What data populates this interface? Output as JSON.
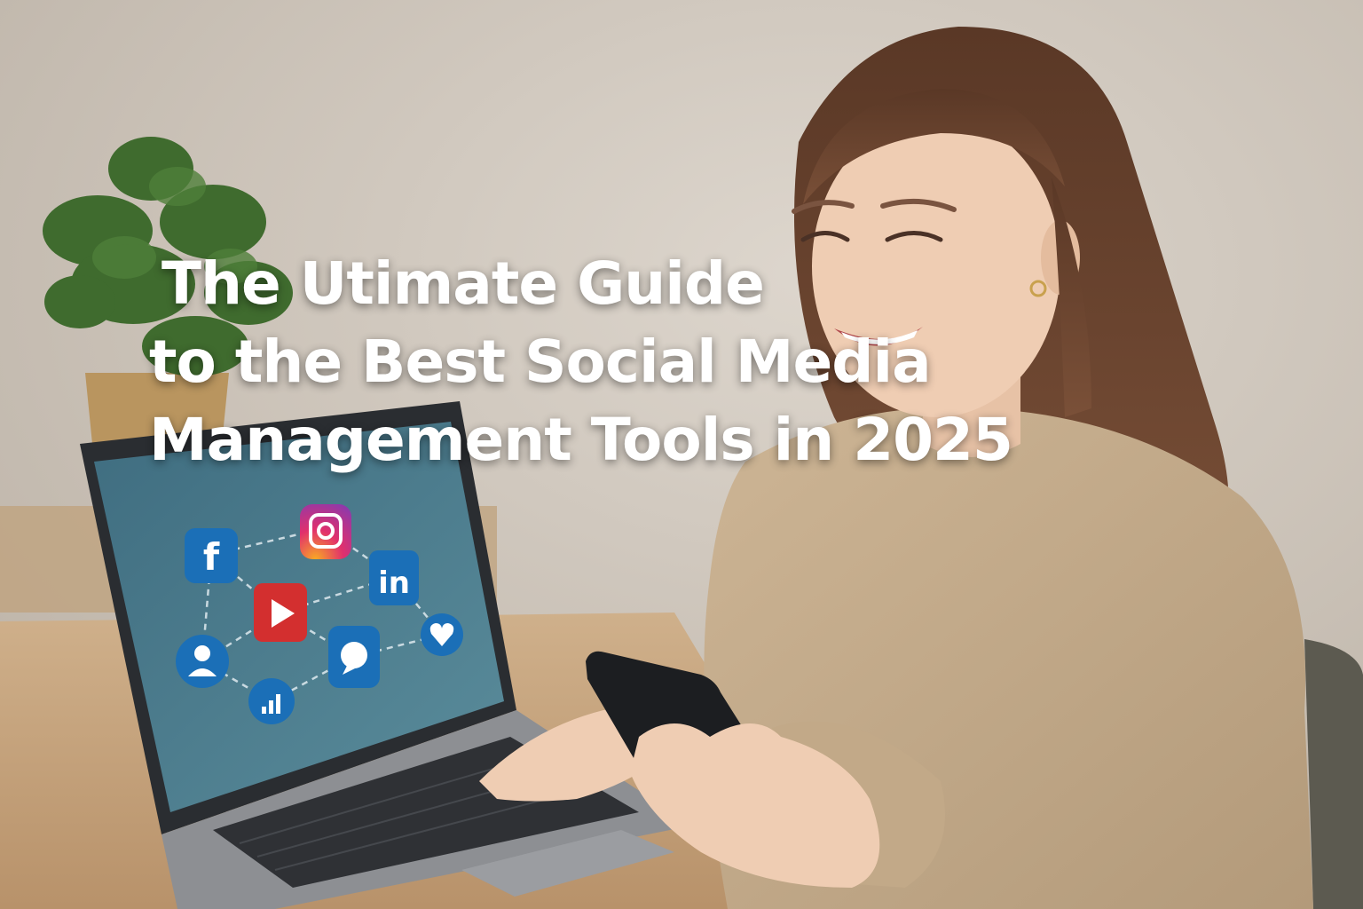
{
  "headline": {
    "line1": "The Utimate Guide",
    "line2": "to the Best Social Media",
    "line3": "Management Tools in 2025"
  },
  "colors": {
    "headline_text": "#ffffff",
    "wall": "#d3cbc1",
    "desk": "#c9aa85",
    "sweater": "#c6ad8d",
    "hair": "#6b4430",
    "laptop_screen": "#4a7d8f",
    "icon_blue": "#1b6fb7",
    "icon_red": "#d32f2f"
  },
  "screen_icons": [
    "facebook-icon",
    "instagram-icon",
    "linkedin-icon",
    "youtube-icon",
    "user-icon",
    "chat-icon",
    "heart-icon",
    "bar-chart-icon"
  ]
}
